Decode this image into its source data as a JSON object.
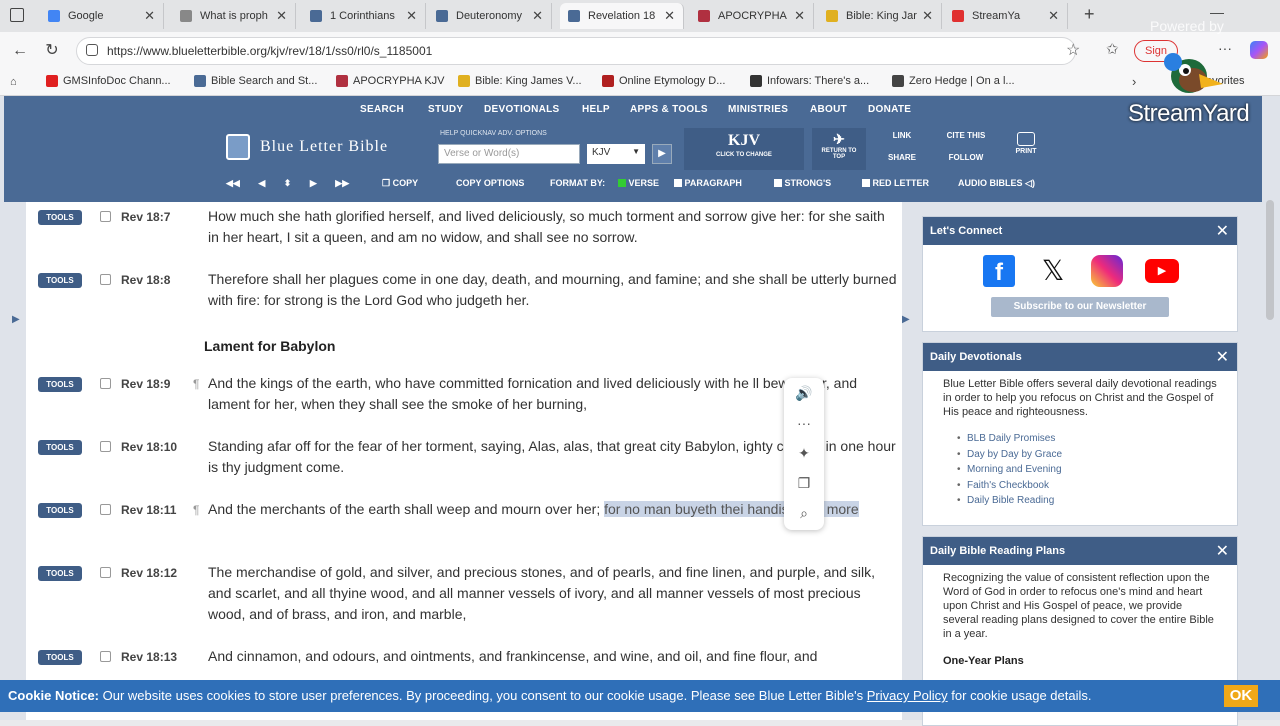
{
  "tabs": [
    {
      "title": "Google",
      "color": "#4285f4"
    },
    {
      "title": "What is proph",
      "color": "#888888"
    },
    {
      "title": "1 Corinthians",
      "color": "#4a6a95"
    },
    {
      "title": "Deuteronomy",
      "color": "#4a6a95"
    },
    {
      "title": "Revelation 18",
      "color": "#4a6a95"
    },
    {
      "title": "APOCRYPHA",
      "color": "#b03040"
    },
    {
      "title": "Bible: King Jar",
      "color": "#e0b020"
    },
    {
      "title": "StreamYa",
      "color": "#e03030"
    }
  ],
  "browser": {
    "url": "https://www.blueletterbible.org/kjv/rev/18/1/ss0/rl0/s_1185001",
    "sign_in": "Sign"
  },
  "bookmarks": [
    {
      "label": "GMSInfoDoc Chann...",
      "color": "#e02020"
    },
    {
      "label": "Bible Search and St...",
      "color": "#4a6a95"
    },
    {
      "label": "APOCRYPHA KJV",
      "color": "#b03040"
    },
    {
      "label": "Bible: King James V...",
      "color": "#e0b020"
    },
    {
      "label": "Online Etymology D...",
      "color": "#b02020"
    },
    {
      "label": "Infowars: There's a...",
      "color": "#333333"
    },
    {
      "label": "Zero Hedge | On a l...",
      "color": "#444444"
    },
    {
      "label": "avorites",
      "color": ""
    }
  ],
  "blb": {
    "topnav": [
      "SEARCH",
      "STUDY",
      "DEVOTIONALS",
      "HELP",
      "APPS & TOOLS",
      "MINISTRIES",
      "ABOUT",
      "DONATE"
    ],
    "logo": "Blue Letter Bible",
    "search_labels": "HELP   QUICKNAV   ADV. OPTIONS",
    "search_placeholder": "Verse or Word(s)",
    "version_select": "KJV",
    "version_big": "KJV",
    "version_sub": "CLICK TO CHANGE",
    "return_top": "RETURN TO TOP",
    "link": "LINK",
    "share": "SHARE",
    "cite": "CITE THIS",
    "follow": "FOLLOW",
    "print": "PRINT",
    "toolbar": {
      "copy": "COPY",
      "copy_options": "COPY OPTIONS",
      "format_by": "FORMAT BY:",
      "verse": "VERSE",
      "paragraph": "PARAGRAPH",
      "strongs": "STRONG'S",
      "red_letter": "RED LETTER",
      "audio": "AUDIO BIBLES"
    }
  },
  "verses": [
    {
      "tools": "TOOLS",
      "ref": "Rev 18:7",
      "para": "",
      "text": "How much she hath glorified herself, and lived deliciously, so much torment and sorrow give her: for she saith in her heart, I sit a queen, and am no widow, and shall see no sorrow."
    },
    {
      "tools": "TOOLS",
      "ref": "Rev 18:8",
      "para": "",
      "text": "Therefore shall her plagues come in one day, death, and mourning, and famine; and she shall be utterly burned with fire: for strong is the Lord God who judgeth her."
    },
    {
      "tools": "TOOLS",
      "ref": "Rev 18:9",
      "para": "¶",
      "text": "And the kings of the earth, who have committed fornication and lived deliciously with he ll bewail her, and lament for her, when they shall see the smoke of her burning,"
    },
    {
      "tools": "TOOLS",
      "ref": "Rev 18:10",
      "para": "",
      "text": "Standing afar off for the fear of her torment, saying, Alas, alas, that great city Babylon, ighty city! for in one hour is thy judgment come."
    },
    {
      "tools": "TOOLS",
      "ref": "Rev 18:11",
      "para": "¶",
      "text_before": "And the merchants of the earth shall weep and mourn over her; ",
      "text_highlight": "for no man buyeth thei handise any more"
    },
    {
      "tools": "TOOLS",
      "ref": "Rev 18:12",
      "para": "",
      "text": "The merchandise of gold, and silver, and precious stones, and of pearls, and fine linen, and purple, and silk, and scarlet, and all thyine wood, and all manner vessels of ivory, and all manner vessels of most precious wood, and of brass, and iron, and marble,"
    },
    {
      "tools": "TOOLS",
      "ref": "Rev 18:13",
      "para": "",
      "text": "And cinnamon, and odours, and ointments, and frankincense, and wine, and oil, and fine flour, and"
    }
  ],
  "heading": "Lament for Babylon",
  "sidebar": {
    "connect": {
      "title": "Let's Connect",
      "newsletter": "Subscribe to our Newsletter"
    },
    "devotionals": {
      "title": "Daily Devotionals",
      "text": "Blue Letter Bible offers several daily devotional readings in order to help you refocus on Christ and the Gospel of His peace and righteousness.",
      "links": [
        "BLB Daily Promises",
        "Day by Day by Grace",
        "Morning and Evening",
        "Faith's Checkbook",
        "Daily Bible Reading"
      ]
    },
    "plans": {
      "title": "Daily Bible Reading Plans",
      "text": "Recognizing the value of consistent reflection upon the Word of God in order to refocus one's mind and heart upon Christ and His Gospel of peace, we provide several reading plans designed to cover the entire Bible in a year.",
      "subhead": "One-Year Plans"
    }
  },
  "cookie": {
    "label": "Cookie Notice:",
    "text": " Our website uses cookies to store user preferences. By proceeding, you consent to our cookie usage. Please see Blue Letter Bible's ",
    "link": "Privacy Policy",
    "text2": " for cookie usage details.",
    "ok": "OK"
  },
  "overlay": {
    "powered": "Powered by",
    "brand": "StreamYard"
  },
  "colors": {
    "blb_blue": "#4a6a95",
    "panel_blue": "#3f5d86",
    "cookie_blue": "#2f6fb8",
    "ok_orange": "#f0a818",
    "highlight": "#c9d4e6"
  }
}
